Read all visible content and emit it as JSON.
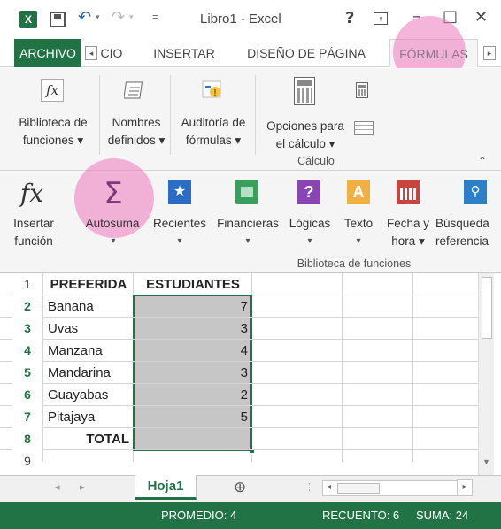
{
  "titlebar": {
    "title": "Libro1 - Excel",
    "help": "?",
    "restore_ribbon": "⊼",
    "minimize": "–",
    "maximize": "□",
    "close": "✕"
  },
  "tabs": [
    {
      "label": "ARCHIVO",
      "active": false
    },
    {
      "label": "CIO",
      "active": false
    },
    {
      "label": "INSERTAR",
      "active": false
    },
    {
      "label": "DISEÑO DE PÁGINA",
      "active": false
    },
    {
      "label": "FÓRMULAS",
      "active": true
    }
  ],
  "ribbon_collapsed": {
    "buttons": [
      {
        "line1": "Biblioteca de",
        "line2": "funciones ▾"
      },
      {
        "line1": "Nombres",
        "line2": "definidos ▾"
      },
      {
        "line1": "Auditoría de",
        "line2": "fórmulas ▾"
      },
      {
        "line1": "Opciones para",
        "line2": "el cálculo ▾"
      }
    ],
    "group": "Cálculo"
  },
  "ribbon_expanded": {
    "buttons": [
      {
        "line1": "Insertar",
        "line2": "función"
      },
      {
        "line1": "Autosuma",
        "line2": "▾"
      },
      {
        "line1": "Recientes",
        "line2": "▾"
      },
      {
        "line1": "Financieras",
        "line2": "▾"
      },
      {
        "line1": "Lógicas",
        "line2": "▾"
      },
      {
        "line1": "Texto",
        "line2": "▾"
      },
      {
        "line1": "Fecha y",
        "line2": "hora ▾"
      },
      {
        "line1": "Búsqueda",
        "line2": "referencia"
      }
    ],
    "group": "Biblioteca de funciones"
  },
  "sheet": {
    "headers": [
      "PREFERIDA",
      "ESTUDIANTES"
    ],
    "rows": [
      {
        "num": "2",
        "a": "Banana",
        "b": "7"
      },
      {
        "num": "3",
        "a": "Uvas",
        "b": "3"
      },
      {
        "num": "4",
        "a": "Manzana",
        "b": "4"
      },
      {
        "num": "5",
        "a": "Mandarina",
        "b": "3"
      },
      {
        "num": "6",
        "a": "Guayabas",
        "b": "2"
      },
      {
        "num": "7",
        "a": "Pitajaya",
        "b": "5"
      }
    ],
    "total_row": {
      "num": "8",
      "a": "TOTAL",
      "b": ""
    },
    "header_row_num": "1",
    "last_row_num": "9"
  },
  "sheetbar": {
    "sheet_tab": "Hoja1",
    "add_sheet": "⊕"
  },
  "status": {
    "promedio": "PROMEDIO: 4",
    "recuento": "RECUENTO: 6",
    "suma": "SUMA: 24"
  },
  "colors": {
    "excel_green": "#217346",
    "selection_fill": "#c6c6c6",
    "highlight_pink": "#ec78be"
  }
}
